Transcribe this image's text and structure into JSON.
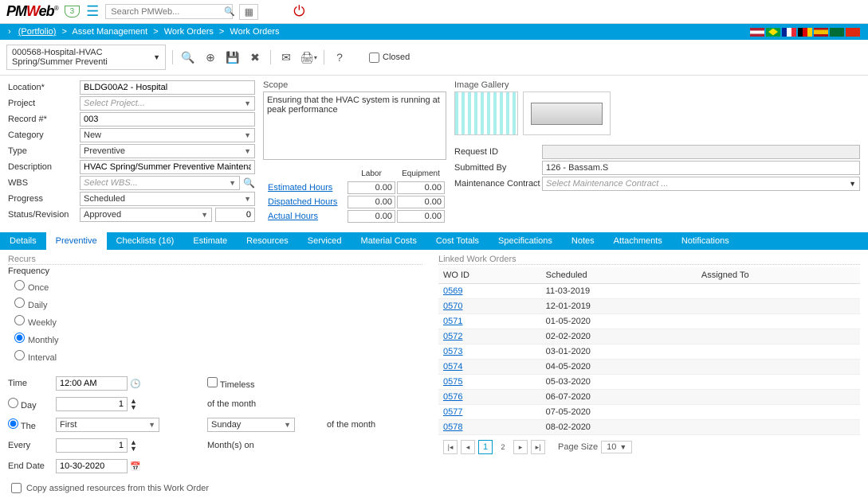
{
  "header": {
    "search_placeholder": "Search PMWeb...",
    "shield_count": "3"
  },
  "breadcrumb": {
    "portfolio": "(Portfolio)",
    "asset_mgmt": "Asset Management",
    "work_orders1": "Work Orders",
    "work_orders2": "Work Orders"
  },
  "toolbar": {
    "doc_selected": "000568-Hospital-HVAC Spring/Summer Preventi",
    "closed_label": "Closed"
  },
  "form": {
    "location_label": "Location*",
    "location_value": "BLDG00A2 - Hospital",
    "project_label": "Project",
    "project_placeholder": "Select Project...",
    "record_label": "Record #*",
    "record_value": "003",
    "category_label": "Category",
    "category_value": "New",
    "type_label": "Type",
    "type_value": "Preventive",
    "description_label": "Description",
    "description_value": "HVAC Spring/Summer Preventive Maintenance",
    "wbs_label": "WBS",
    "wbs_placeholder": "Select WBS...",
    "progress_label": "Progress",
    "progress_value": "Scheduled",
    "status_label": "Status/Revision",
    "status_value": "Approved",
    "revision_value": "0"
  },
  "scope": {
    "label": "Scope",
    "text": "Ensuring that the HVAC system is running at peak performance"
  },
  "hours": {
    "labor_hdr": "Labor",
    "equip_hdr": "Equipment",
    "est_label": "Estimated Hours",
    "disp_label": "Dispatched Hours",
    "act_label": "Actual Hours",
    "est_labor": "0.00",
    "est_equip": "0.00",
    "disp_labor": "0.00",
    "disp_equip": "0.00",
    "act_labor": "0.00",
    "act_equip": "0.00"
  },
  "gallery": {
    "label": "Image Gallery"
  },
  "request": {
    "reqid_label": "Request ID",
    "submitted_by_label": "Submitted By",
    "submitted_by_value": "126 - Bassam.S",
    "maint_contract_label": "Maintenance Contract",
    "maint_contract_placeholder": "Select Maintenance Contract ..."
  },
  "tabs": {
    "details": "Details",
    "preventive": "Preventive",
    "checklists": "Checklists (16)",
    "estimate": "Estimate",
    "resources": "Resources",
    "serviced": "Serviced",
    "material": "Material Costs",
    "cost": "Cost Totals",
    "specs": "Specifications",
    "notes": "Notes",
    "attachments": "Attachments",
    "notifications": "Notifications"
  },
  "recurs": {
    "title": "Recurs",
    "freq_label": "Frequency",
    "once": "Once",
    "daily": "Daily",
    "weekly": "Weekly",
    "monthly": "Monthly",
    "interval": "Interval",
    "time_label": "Time",
    "time_value": "12:00 AM",
    "timeless_label": "Timeless",
    "day_label": "Day",
    "day_value": "1",
    "of_month1": "of the month",
    "the_label": "The",
    "the_ord": "First",
    "the_dow": "Sunday",
    "of_month2": "of the month",
    "every_label": "Every",
    "every_value": "1",
    "months_on": "Month(s) on",
    "end_label": "End Date",
    "end_value": "10-30-2020",
    "copy_label": "Copy assigned resources from this Work Order"
  },
  "linked": {
    "title": "Linked Work Orders",
    "col_woid": "WO ID",
    "col_sched": "Scheduled",
    "col_assigned": "Assigned To",
    "rows": [
      {
        "id": "0569",
        "sched": "11-03-2019"
      },
      {
        "id": "0570",
        "sched": "12-01-2019"
      },
      {
        "id": "0571",
        "sched": "01-05-2020"
      },
      {
        "id": "0572",
        "sched": "02-02-2020"
      },
      {
        "id": "0573",
        "sched": "03-01-2020"
      },
      {
        "id": "0574",
        "sched": "04-05-2020"
      },
      {
        "id": "0575",
        "sched": "05-03-2020"
      },
      {
        "id": "0576",
        "sched": "06-07-2020"
      },
      {
        "id": "0577",
        "sched": "07-05-2020"
      },
      {
        "id": "0578",
        "sched": "08-02-2020"
      }
    ],
    "page1": "1",
    "page2": "2",
    "page_size_label": "Page Size",
    "page_size_value": "10"
  }
}
